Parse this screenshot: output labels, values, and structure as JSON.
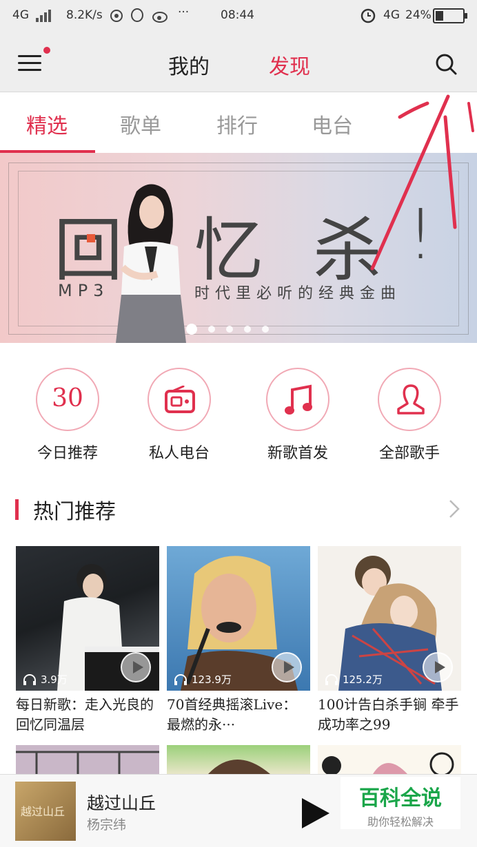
{
  "status_bar": {
    "network": "4G",
    "speed": "8.2K/s",
    "more": "···",
    "time": "08:44",
    "net2": "4G",
    "battery": "24%"
  },
  "header": {
    "tabs": [
      {
        "label": "我的",
        "active": false
      },
      {
        "label": "发现",
        "active": true
      }
    ],
    "menu_icon": "menu-icon",
    "search_icon": "search-icon"
  },
  "category_tabs": [
    "精选",
    "歌单",
    "排行",
    "电台"
  ],
  "banner": {
    "headline": [
      "回",
      "忆",
      "杀",
      "!"
    ],
    "left_caption": "MP3",
    "right_caption": "时代里必听的经典金曲",
    "pages": 5,
    "current_page": 1
  },
  "quick_entries": [
    {
      "label": "今日推荐",
      "icon": "calendar-30-icon",
      "icon_text": "30"
    },
    {
      "label": "私人电台",
      "icon": "radio-icon"
    },
    {
      "label": "新歌首发",
      "icon": "music-note-icon"
    },
    {
      "label": "全部歌手",
      "icon": "person-icon"
    }
  ],
  "hot_section": {
    "title": "热门推荐"
  },
  "playlists": [
    {
      "play_count": "3.9万",
      "title": "每日新歌：走入光良的回忆同温层"
    },
    {
      "play_count": "123.9万",
      "title": "70首经典摇滚Live：最燃的永···"
    },
    {
      "play_count": "125.2万",
      "title": "100计告白杀手锏 牵手成功率之99"
    }
  ],
  "now_playing": {
    "art_text": "越过山丘",
    "song": "越过山丘",
    "artist": "杨宗纬"
  },
  "watermark": {
    "title": "百科全说",
    "subtitle": "助你轻松解决"
  },
  "colors": {
    "accent": "#e0304e",
    "header_bg": "#eeeeee"
  }
}
